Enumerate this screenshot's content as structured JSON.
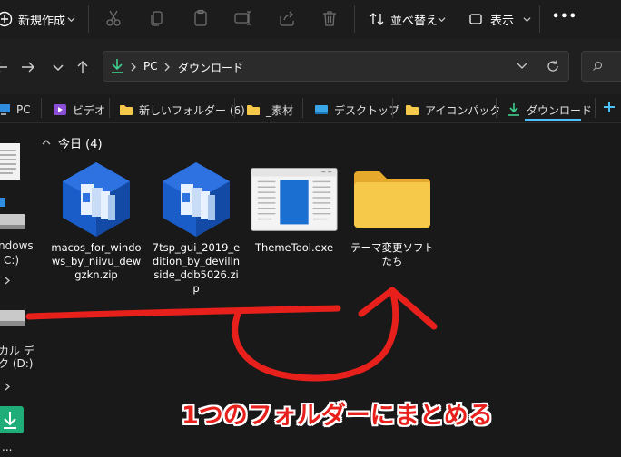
{
  "toolbar": {
    "new_label": "新規作成",
    "sort_label": "並べ替え",
    "view_label": "表示",
    "more_label": "•••"
  },
  "address": {
    "crumbs": [
      "PC",
      "ダウンロード"
    ]
  },
  "quick_access": [
    {
      "label": "PC",
      "icon": "pc-icon"
    },
    {
      "label": "ビデオ",
      "icon": "video-folder-icon"
    },
    {
      "label": "新しいフォルダー (6)",
      "icon": "folder-icon"
    },
    {
      "label": "_素材",
      "icon": "folder-icon"
    },
    {
      "label": "デスクトップ",
      "icon": "desktop-icon"
    },
    {
      "label": "アイコンパック",
      "icon": "folder-icon"
    },
    {
      "label": "ダウンロード",
      "icon": "download-icon"
    }
  ],
  "nav": {
    "drive_c_line1": "ndows",
    "drive_c_line2": "C:)",
    "drive_d_line1": "カル デ",
    "drive_d_line2": "ク (D:)",
    "bottom_label": "..."
  },
  "group": {
    "label": "今日 (4)"
  },
  "files": [
    {
      "name": "macos_for_windows_by_niivu_dewgzkn.zip",
      "icon": "winrar-zip-icon"
    },
    {
      "name": "7tsp_gui_2019_edition_by_devillnside_ddb5026.zip",
      "icon": "winrar-zip-icon"
    },
    {
      "name": "ThemeTool.exe",
      "icon": "app-window-icon"
    },
    {
      "name": "テーマ変更ソフトたち",
      "icon": "folder-icon"
    }
  ],
  "annotation": {
    "text": "1つのフォルダーにまとめる",
    "color": "#e8201c"
  },
  "colors": {
    "background": "#191919",
    "accent": "#4cc2ff",
    "folder": "#f7c94b"
  }
}
